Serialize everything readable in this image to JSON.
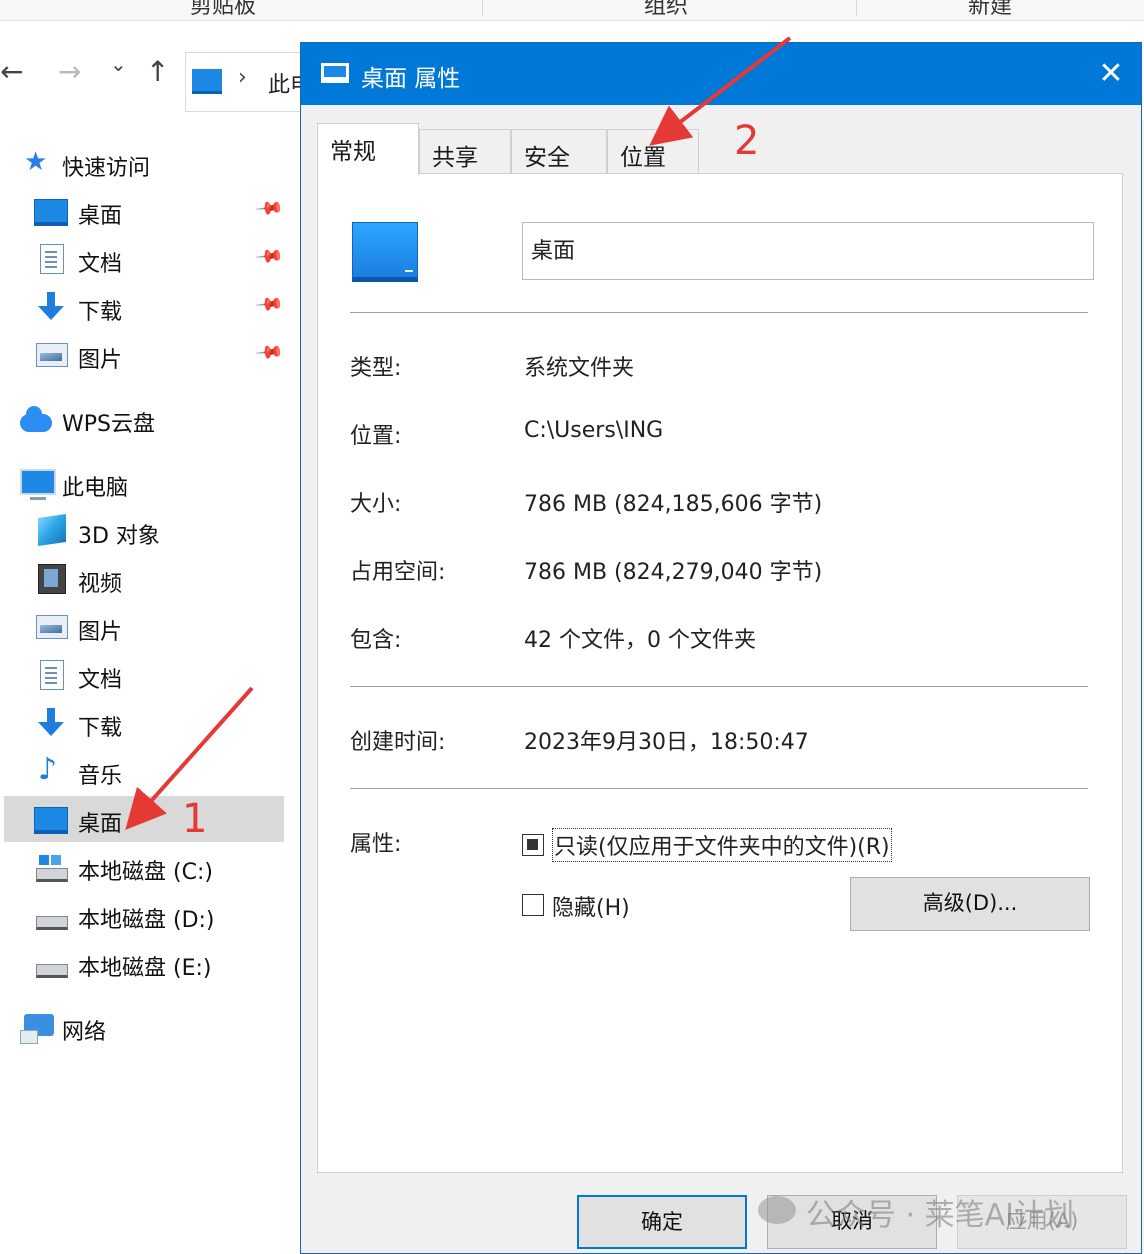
{
  "explorer": {
    "ribbon_groups": [
      "剪贴板",
      "组织",
      "新建"
    ],
    "address": {
      "segment": "此电脑"
    },
    "sidebar": {
      "quick_access": "快速访问",
      "quick_items": [
        {
          "label": "桌面",
          "icon": "desktop-icon",
          "pinned": true
        },
        {
          "label": "文档",
          "icon": "document-icon",
          "pinned": true
        },
        {
          "label": "下载",
          "icon": "download-icon",
          "pinned": true
        },
        {
          "label": "图片",
          "icon": "picture-icon",
          "pinned": true
        }
      ],
      "wps": "WPS云盘",
      "this_pc": "此电脑",
      "pc_items": [
        {
          "label": "3D 对象",
          "icon": "3d-objects-icon"
        },
        {
          "label": "视频",
          "icon": "video-icon"
        },
        {
          "label": "图片",
          "icon": "picture-icon"
        },
        {
          "label": "文档",
          "icon": "document-icon"
        },
        {
          "label": "下载",
          "icon": "download-icon"
        },
        {
          "label": "音乐",
          "icon": "music-icon"
        },
        {
          "label": "桌面",
          "icon": "desktop-icon",
          "selected": true
        },
        {
          "label": "本地磁盘 (C:)",
          "icon": "system-drive-icon"
        },
        {
          "label": "本地磁盘 (D:)",
          "icon": "drive-icon"
        },
        {
          "label": "本地磁盘 (E:)",
          "icon": "drive-icon"
        }
      ],
      "network": "网络"
    }
  },
  "dialog": {
    "title": "桌面 属性",
    "tabs": [
      {
        "label": "常规",
        "active": true
      },
      {
        "label": "共享"
      },
      {
        "label": "安全"
      },
      {
        "label": "位置"
      }
    ],
    "folder_name": "桌面",
    "properties": [
      {
        "label": "类型:",
        "value": "系统文件夹"
      },
      {
        "label": "位置:",
        "value": "C:\\Users\\ING"
      },
      {
        "label": "大小:",
        "value": "786 MB (824,185,606 字节)"
      },
      {
        "label": "占用空间:",
        "value": "786 MB (824,279,040 字节)"
      },
      {
        "label": "包含:",
        "value": "42 个文件，0 个文件夹"
      }
    ],
    "created": {
      "label": "创建时间:",
      "value": "2023年9月30日，18:50:47"
    },
    "attributes": {
      "label": "属性:",
      "readonly": "只读(仅应用于文件夹中的文件)(R)",
      "hidden": "隐藏(H)",
      "advanced": "高级(D)..."
    },
    "buttons": {
      "ok": "确定",
      "cancel": "取消",
      "apply": "应用(A)"
    }
  },
  "annotations": {
    "step1": "1",
    "step2": "2",
    "arrow_color": "#e53935"
  },
  "watermark": "公众号 · 莱笔AI计划",
  "colors": {
    "titlebar": "#0078d7",
    "selection": "#d9d9d9"
  }
}
